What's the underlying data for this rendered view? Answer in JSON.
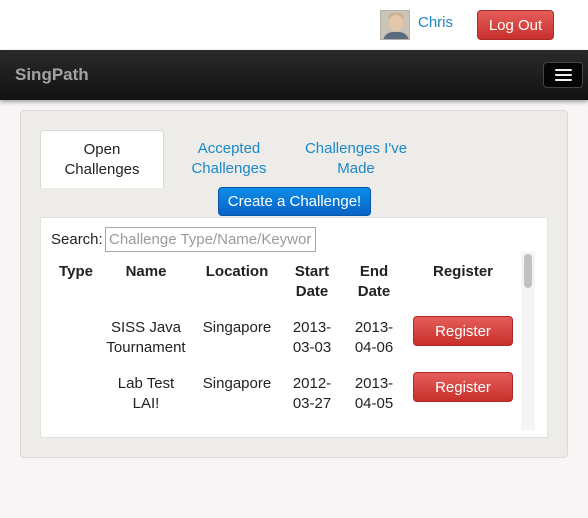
{
  "user": {
    "name": "Chris",
    "logout_label": "Log Out"
  },
  "navbar": {
    "brand": "SingPath"
  },
  "tabs": [
    {
      "line1": "Open",
      "line2": "Challenges"
    },
    {
      "line1": "Accepted",
      "line2": "Challenges"
    },
    {
      "line1": "Challenges I've",
      "line2": "Made"
    }
  ],
  "create_label": "Create a Challenge!",
  "search": {
    "label": "Search:",
    "placeholder": "Challenge Type/Name/Keywords"
  },
  "table": {
    "headers": [
      "Type",
      "Name",
      "Location",
      "Start",
      "Date",
      "End",
      "Date",
      "Register"
    ],
    "rows": [
      {
        "type": "",
        "name1": "SISS Java",
        "name2": "Tournament",
        "location": "Singapore",
        "start1": "2013-",
        "start2": "03-03",
        "end1": "2013-",
        "end2": "04-06",
        "action": "Register"
      },
      {
        "type": "",
        "name1": "Lab Test",
        "name2": "LAI!",
        "location": "Singapore",
        "start1": "2012-",
        "start2": "03-27",
        "end1": "2013-",
        "end2": "04-05",
        "action": "Register"
      }
    ]
  },
  "colors": {
    "link": "#1a88c9",
    "danger": "#d0403c",
    "primary": "#0a74d8",
    "navbar": "#1b1b1b"
  }
}
